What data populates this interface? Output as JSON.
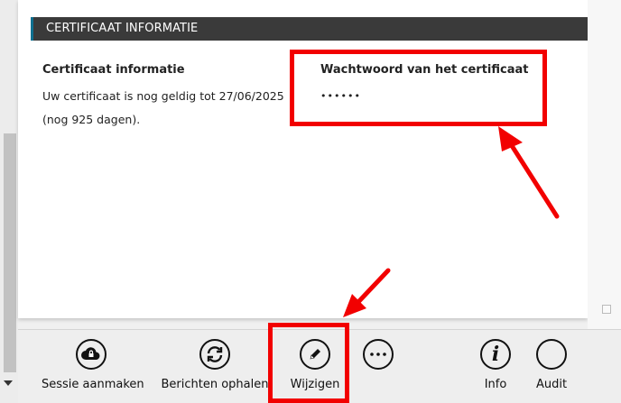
{
  "section": {
    "header": "CERTIFICAAT INFORMATIE"
  },
  "certificate": {
    "title": "Certificaat informatie",
    "line1": "Uw certificaat is nog geldig tot 27/06/2025",
    "line2": "(nog 925 dagen)."
  },
  "password": {
    "title": "Wachtwoord van het certificaat",
    "masked": "••••••"
  },
  "toolbar": {
    "buttons": [
      {
        "label": "Sessie aanmaken",
        "icon": "cloud-lock-icon"
      },
      {
        "label": "Berichten ophalen",
        "icon": "refresh-icon"
      },
      {
        "label": "Wijzigen",
        "icon": "pencil-icon"
      },
      {
        "label": "",
        "icon": "more-icon"
      },
      {
        "label": "Info",
        "icon": "info-icon"
      },
      {
        "label": "Audit",
        "icon": "audit-icon"
      }
    ]
  },
  "colors": {
    "header_bg": "#3a3a3a",
    "header_accent": "#0f6f8f",
    "annotation": "#f20000"
  }
}
